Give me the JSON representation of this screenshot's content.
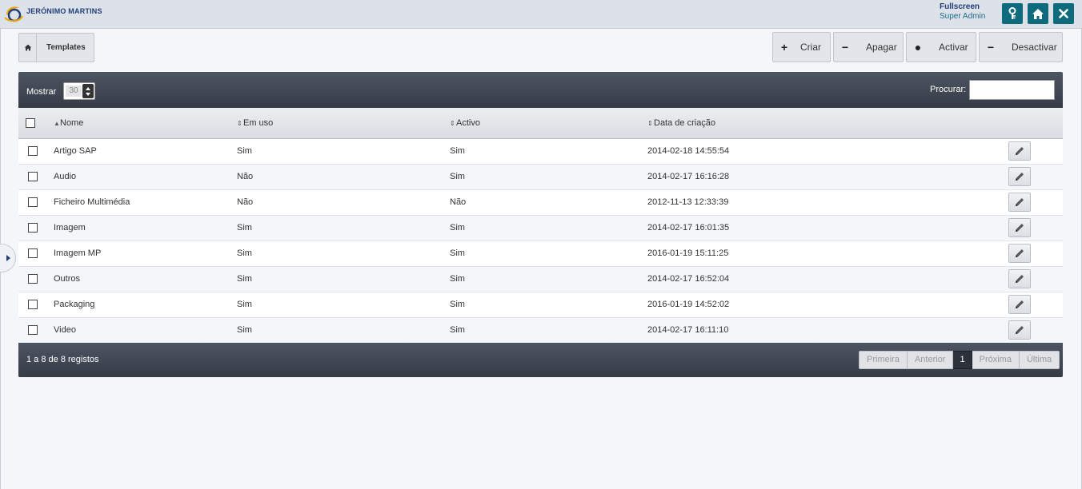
{
  "header": {
    "brand": "JERÓNIMO MARTINS",
    "mode": "Fullscreen",
    "role": "Super Admin",
    "icons": [
      "key-icon",
      "home-icon",
      "close-icon"
    ],
    "accent_color": "#0e6b7e"
  },
  "breadcrumb": {
    "home_icon": "home-icon",
    "current": "Templates"
  },
  "actions": {
    "create": "Criar",
    "delete": "Apagar",
    "activate": "Activar",
    "deactivate": "Desactivar"
  },
  "toolbar": {
    "show_label": "Mostrar",
    "page_size": "30",
    "search_label": "Procurar:",
    "search_value": ""
  },
  "table": {
    "columns": {
      "name": "Nome",
      "in_use": "Em uso",
      "active": "Activo",
      "created": "Data de criação"
    },
    "rows": [
      {
        "name": "Artigo SAP",
        "in_use": "Sim",
        "active": "Sim",
        "created": "2014-02-18 14:55:54"
      },
      {
        "name": "Audio",
        "in_use": "Não",
        "active": "Sim",
        "created": "2014-02-17 16:16:28"
      },
      {
        "name": "Ficheiro Multimédia",
        "in_use": "Não",
        "active": "Não",
        "created": "2012-11-13 12:33:39"
      },
      {
        "name": "Imagem",
        "in_use": "Sim",
        "active": "Sim",
        "created": "2014-02-17 16:01:35"
      },
      {
        "name": "Imagem MP",
        "in_use": "Sim",
        "active": "Sim",
        "created": "2016-01-19 15:11:25"
      },
      {
        "name": "Outros",
        "in_use": "Sim",
        "active": "Sim",
        "created": "2014-02-17 16:52:04"
      },
      {
        "name": "Packaging",
        "in_use": "Sim",
        "active": "Sim",
        "created": "2016-01-19 14:52:02"
      },
      {
        "name": "Video",
        "in_use": "Sim",
        "active": "Sim",
        "created": "2014-02-17 16:11:10"
      }
    ]
  },
  "footer": {
    "record_info": "1 a 8 de 8 registos",
    "pager": {
      "first": "Primeira",
      "previous": "Anterior",
      "current": "1",
      "next": "Próxima",
      "last": "Última"
    }
  }
}
